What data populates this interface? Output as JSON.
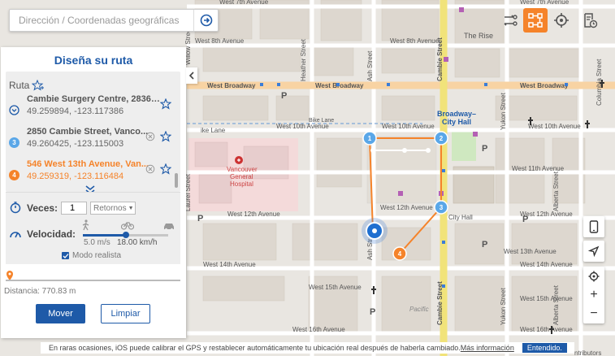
{
  "search": {
    "placeholder": "Dirección / Coordenadas geográficas"
  },
  "panel": {
    "title": "Diseña su ruta",
    "route_label": "Ruta",
    "stops": [
      {
        "badge": "",
        "name": "Cambie Surgery Centre, 2836 As...",
        "coord": "49.259894, -123.117386",
        "state": "start"
      },
      {
        "badge": "3",
        "name": "2850 Cambie Street, Vanco...",
        "coord": "49.260425, -123.115003",
        "state": "normal"
      },
      {
        "badge": "4",
        "name": "546 West 13th Avenue, Van...",
        "coord": "49.259319, -123.116484",
        "state": "active"
      }
    ],
    "times_label": "Veces:",
    "times_value": "1",
    "returns_label": "Retornos",
    "speed_label": "Velocidad:",
    "speed_ms": "5.0 m/s",
    "speed_kmh": "18.00 km/h",
    "speed_fraction": 0.5,
    "realistic_label": "Modo realista",
    "realistic_checked": true,
    "distance_label": "Distancia: 770.83 m",
    "move_button": "Mover",
    "clear_button": "Limpiar"
  },
  "bottom": {
    "message": "En raras ocasiones, iOS puede calibrar el GPS y restablecer automáticamente tu ubicación real después de haberla cambiado.",
    "more_info": "Más información",
    "ok_button": "Entendido.",
    "contributors": "ntributors"
  },
  "map": {
    "streets": [
      "West 7th Avenue",
      "West 7th Avenue",
      "West 8th Avenue",
      "West 8th Avenue",
      "West Broadway",
      "West Broadway",
      "West Broadway",
      "West 10th Avenue",
      "West 10th Avenue",
      "West 10th Avenue",
      "West 11th Avenue",
      "West 12th Avenue",
      "West 12th Avenue",
      "West 12th Avenue",
      "West 13th Avenue",
      "West 14th Avenue",
      "West 14th Avenue",
      "West 15th Avenue",
      "West 15th Avenue",
      "West 16th Avenue",
      "West 16th Avenue",
      "Heather Street",
      "Ash Street",
      "Ash Street",
      "Cambie Street",
      "Cambie Street",
      "Yukon Street",
      "Yukon Street",
      "Alberta Street",
      "Alberta Street",
      "Columbia Street",
      "Laurel Street",
      "Willow Street",
      "Bike Lane",
      "ike Lane"
    ],
    "places": [
      "The Rise",
      "Broadway–City Hall",
      "Vancouver General Hospital",
      "City Hall",
      "Pacific",
      "P",
      "P",
      "P",
      "P",
      "P",
      "P"
    ],
    "markers": [
      "1",
      "2",
      "3",
      "4"
    ],
    "colors": {
      "route": "#f5832a",
      "accent": "#1e5aa8",
      "active_tool": "#f5832a",
      "arterial": "#f8d3a3",
      "transit": "#f1e37a",
      "hospital_area": "#f4dada",
      "park": "#cfe8c0"
    }
  }
}
